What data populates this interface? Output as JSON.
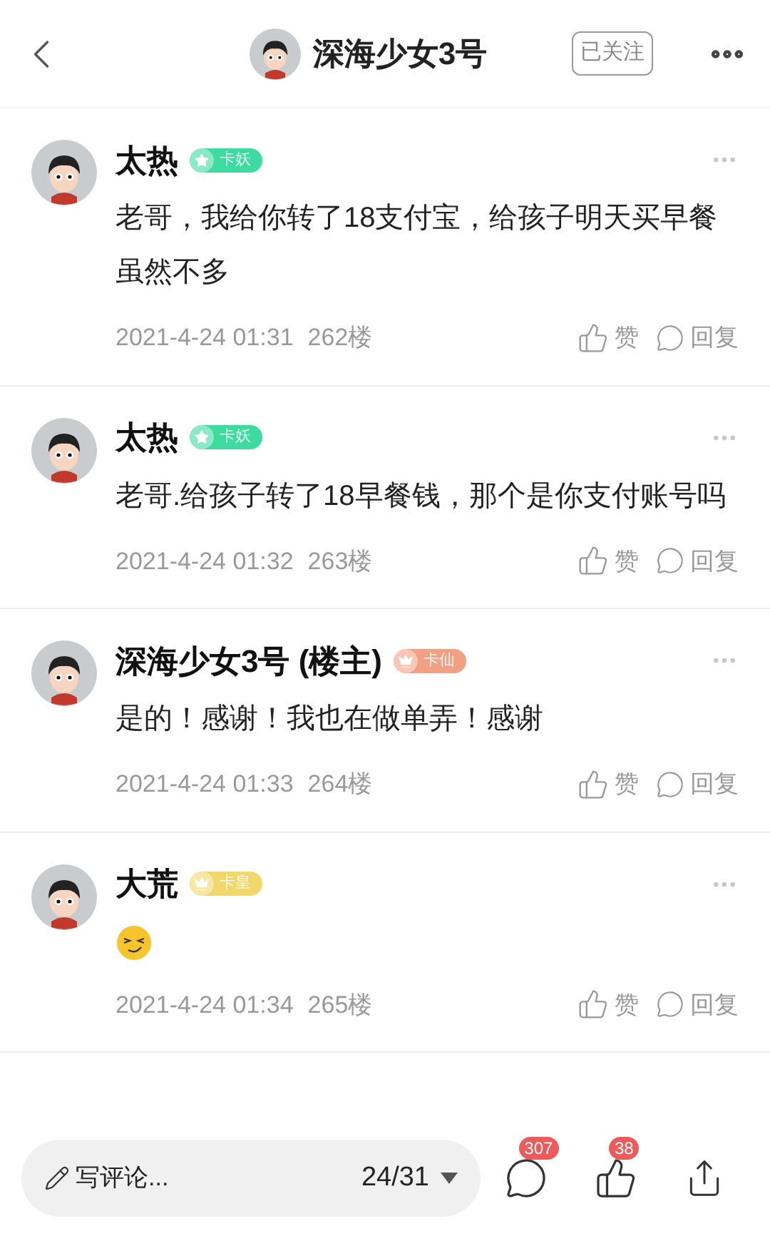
{
  "header": {
    "title": "深海少女3号",
    "follow_button": "已关注"
  },
  "comments": [
    {
      "name": "太热",
      "badge": {
        "label": "卡妖",
        "kind": "star",
        "color": "#3ddba0"
      },
      "body": {
        "kind": "text",
        "text": "老哥，我给你转了18支付宝，给孩子明天买早餐虽然不多"
      },
      "time": "2021-4-24 01:31",
      "floor": "262楼",
      "like": "赞",
      "reply": "回复"
    },
    {
      "name": "太热",
      "badge": {
        "label": "卡妖",
        "kind": "star",
        "color": "#3ddba0"
      },
      "body": {
        "kind": "text",
        "text": "老哥.给孩子转了18早餐钱，那个是你支付账号吗"
      },
      "time": "2021-4-24 01:32",
      "floor": "263楼",
      "like": "赞",
      "reply": "回复"
    },
    {
      "name": "深海少女3号 (楼主)",
      "badge": {
        "label": "卡仙",
        "kind": "crown",
        "color": "#f2a084"
      },
      "body": {
        "kind": "text",
        "text": "是的！感谢！我也在做单弄！感谢"
      },
      "time": "2021-4-24 01:33",
      "floor": "264楼",
      "like": "赞",
      "reply": "回复"
    },
    {
      "name": "大荒",
      "badge": {
        "label": "卡皇",
        "kind": "crown",
        "color": "#f0d86a"
      },
      "body": {
        "kind": "emoji"
      },
      "time": "2021-4-24 01:34",
      "floor": "265楼",
      "like": "赞",
      "reply": "回复"
    }
  ],
  "bottom_bar": {
    "placeholder": "写评论...",
    "page": "24/31",
    "comment_count": "307",
    "like_count": "38"
  }
}
